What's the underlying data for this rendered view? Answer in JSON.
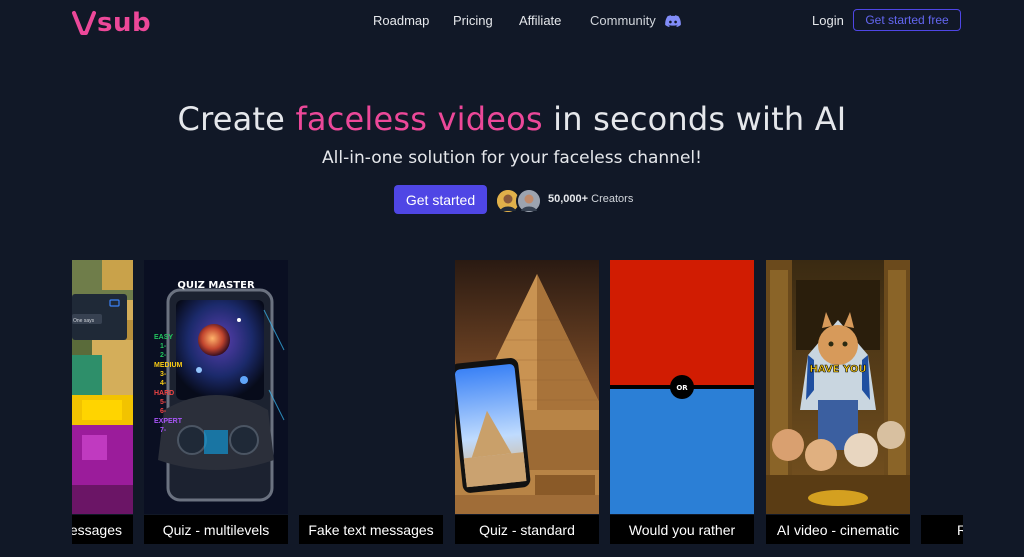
{
  "brand": {
    "name": "sub",
    "color": "#ec4899",
    "accent": "#4f46e5"
  },
  "nav": {
    "items": [
      {
        "label": "Roadmap"
      },
      {
        "label": "Pricing"
      },
      {
        "label": "Affiliate"
      },
      {
        "label": "Community",
        "icon": "discord-icon"
      }
    ],
    "login": "Login",
    "get_started_free": "Get started free"
  },
  "hero": {
    "title_before": "Create ",
    "title_accent": "faceless videos",
    "title_after": " in seconds with AI",
    "subtitle": "All-in-one solution for your faceless channel!",
    "cta": "Get started",
    "creators_count": "50,000+",
    "creators_label": " Creators"
  },
  "cards": [
    {
      "label": "essages",
      "image": "minecraft-fake-messages"
    },
    {
      "label": "Quiz - multilevels",
      "image": "quiz-master-gamepad",
      "overlay": {
        "title": "QUIZ MASTER",
        "levels": [
          "EASY",
          "1-",
          "2-",
          "MEDIUM",
          "3-",
          "4-",
          "HARD",
          "5-",
          "6-",
          "EXPERT",
          "7-"
        ]
      }
    },
    {
      "label": "Fake text messages",
      "image": "blank"
    },
    {
      "label": "Quiz - standard",
      "image": "pyramid-phone"
    },
    {
      "label": "Would you rather",
      "image": "red-blue-split",
      "overlay": {
        "or": "OR"
      }
    },
    {
      "label": "AI video - cinematic",
      "image": "egyptian-cats",
      "overlay": {
        "caption": "HAVE YOU"
      }
    },
    {
      "label": "R",
      "image": "partial"
    }
  ],
  "phone_ui": {
    "caption": "One says"
  }
}
